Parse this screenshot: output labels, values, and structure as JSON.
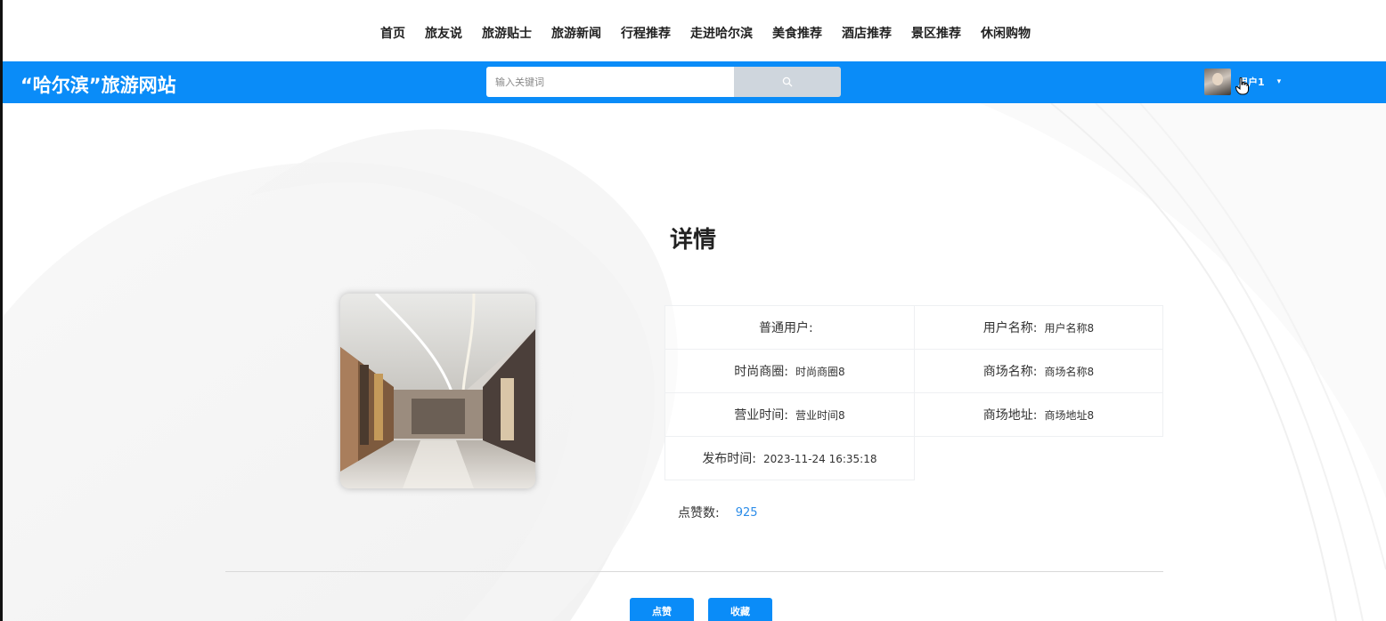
{
  "nav": {
    "items": [
      "首页",
      "旅友说",
      "旅游贴士",
      "旅游新闻",
      "行程推荐",
      "走进哈尔滨",
      "美食推荐",
      "酒店推荐",
      "景区推荐",
      "休闲购物"
    ]
  },
  "header": {
    "site_title": "“哈尔滨”旅游网站",
    "search_placeholder": "输入关键词",
    "user_name": "用户1",
    "accent_color": "#0a8cf8"
  },
  "detail": {
    "title": "详情",
    "rows": [
      [
        {
          "label": "普通用户:",
          "value": ""
        },
        {
          "label": "用户名称:",
          "value": "用户名称8"
        }
      ],
      [
        {
          "label": "时尚商圈:",
          "value": "时尚商圈8"
        },
        {
          "label": "商场名称:",
          "value": "商场名称8"
        }
      ],
      [
        {
          "label": "营业时间:",
          "value": "营业时间8"
        },
        {
          "label": "商场地址:",
          "value": "商场地址8"
        }
      ],
      [
        {
          "label": "发布时间:",
          "value": "2023-11-24 16:35:18"
        },
        {
          "label": "",
          "value": ""
        }
      ]
    ],
    "likes_label": "点赞数:",
    "likes_value": "925"
  },
  "actions": {
    "like_label": "点赞",
    "favorite_label": "收藏"
  }
}
